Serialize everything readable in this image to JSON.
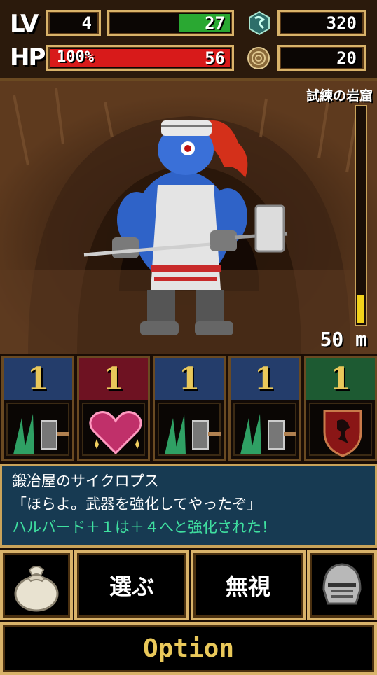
{
  "status": {
    "lv_label": "LV",
    "level": "4",
    "exp": "27",
    "exp_fill": 0.45,
    "gems": "320",
    "hp_label": "HP",
    "hp_percent": "100%",
    "hp_value": "56",
    "hp_fill": 1.0,
    "coins": "20"
  },
  "location": {
    "name": "試練の岩窟",
    "depth": "50 m",
    "depth_fill": 0.14
  },
  "cards": [
    {
      "count": "1",
      "icon": "sword-slash-icon",
      "top_color": "#243d6b"
    },
    {
      "count": "1",
      "icon": "heart-icon",
      "top_color": "#6e1222"
    },
    {
      "count": "1",
      "icon": "sword-slash-icon",
      "top_color": "#243d6b"
    },
    {
      "count": "1",
      "icon": "sword-slash-icon",
      "top_color": "#243d6b"
    },
    {
      "count": "1",
      "icon": "shield-crest-icon",
      "top_color": "#1d5a32"
    }
  ],
  "message": {
    "speaker": "鍛冶屋のサイクロプス",
    "line": "「ほらよ。武器を強化してやったぞ」",
    "result": "ハルバード＋１は＋４へと強化された！",
    "result_color": "#3fe0a0"
  },
  "actions": {
    "choose": "選ぶ",
    "ignore": "無視",
    "option": "Option"
  }
}
